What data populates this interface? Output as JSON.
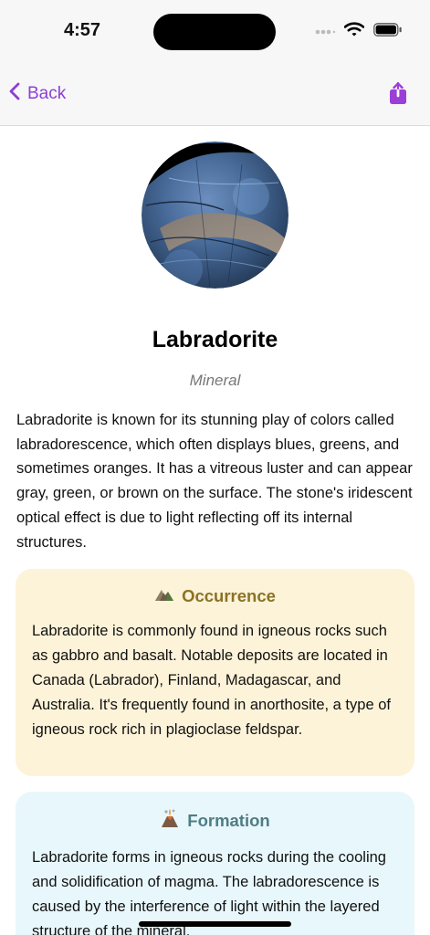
{
  "status_bar": {
    "time": "4:57"
  },
  "nav": {
    "back_label": "Back",
    "accent": "#8e3fd6"
  },
  "mineral": {
    "name": "Labradorite",
    "category": "Mineral",
    "description": "Labradorite is known for its stunning play of colors called labradorescence, which often displays blues, greens, and sometimes oranges. It has a vitreous luster and can appear gray, green, or brown on the surface. The stone's iridescent optical effect is due to light reflecting off its internal structures."
  },
  "sections": {
    "occurrence": {
      "icon": "mountain-icon",
      "title": "Occurrence",
      "color": "#fdf3d9",
      "body": "Labradorite is commonly found in igneous rocks such as gabbro and basalt. Notable deposits are located in Canada (Labrador), Finland, Madagascar, and Australia. It's frequently found in anorthosite, a type of igneous rock rich in plagioclase feldspar."
    },
    "formation": {
      "icon": "volcano-icon",
      "title": "Formation",
      "color": "#e8f7fb",
      "body": "Labradorite forms in igneous rocks during the cooling and solidification of magma. The labradorescence is caused by the interference of light within the layered structure of the mineral."
    }
  }
}
